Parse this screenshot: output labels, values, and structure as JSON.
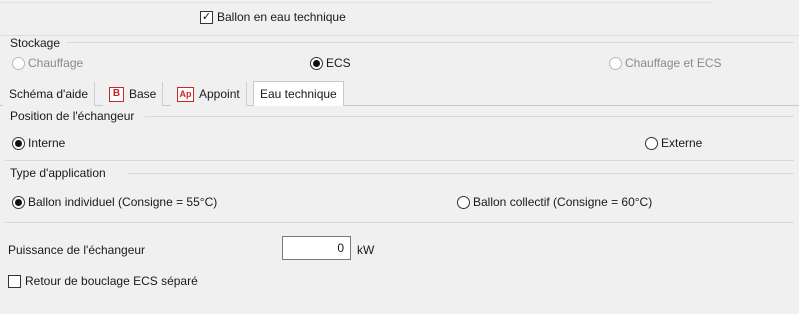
{
  "header": {
    "ballon_label": "Ballon en eau technique",
    "ballon_checked": true
  },
  "stockage": {
    "title": "Stockage",
    "options": [
      {
        "label": "Chauffage",
        "selected": false,
        "disabled": true
      },
      {
        "label": "ECS",
        "selected": true,
        "disabled": false
      },
      {
        "label": "Chauffage et ECS",
        "selected": false,
        "disabled": true
      }
    ]
  },
  "tabs": [
    {
      "label": "Schéma d'aide",
      "icon": "",
      "active": false
    },
    {
      "label": "Base",
      "icon": "B",
      "active": false
    },
    {
      "label": "Appoint",
      "icon": "Ap",
      "active": false
    },
    {
      "label": "Eau technique",
      "icon": "",
      "active": true
    }
  ],
  "position": {
    "title": "Position de l'échangeur",
    "options": [
      {
        "label": "Interne",
        "selected": true
      },
      {
        "label": "Externe",
        "selected": false
      }
    ]
  },
  "application": {
    "title": "Type d'application",
    "options": [
      {
        "label": "Ballon individuel (Consigne = 55°C)",
        "selected": true
      },
      {
        "label": "Ballon collectif (Consigne = 60°C)",
        "selected": false
      }
    ]
  },
  "puissance": {
    "label": "Puissance de l'échangeur",
    "value": "0",
    "unit": "kW"
  },
  "retour": {
    "label": "Retour de bouclage ECS séparé",
    "checked": false
  }
}
